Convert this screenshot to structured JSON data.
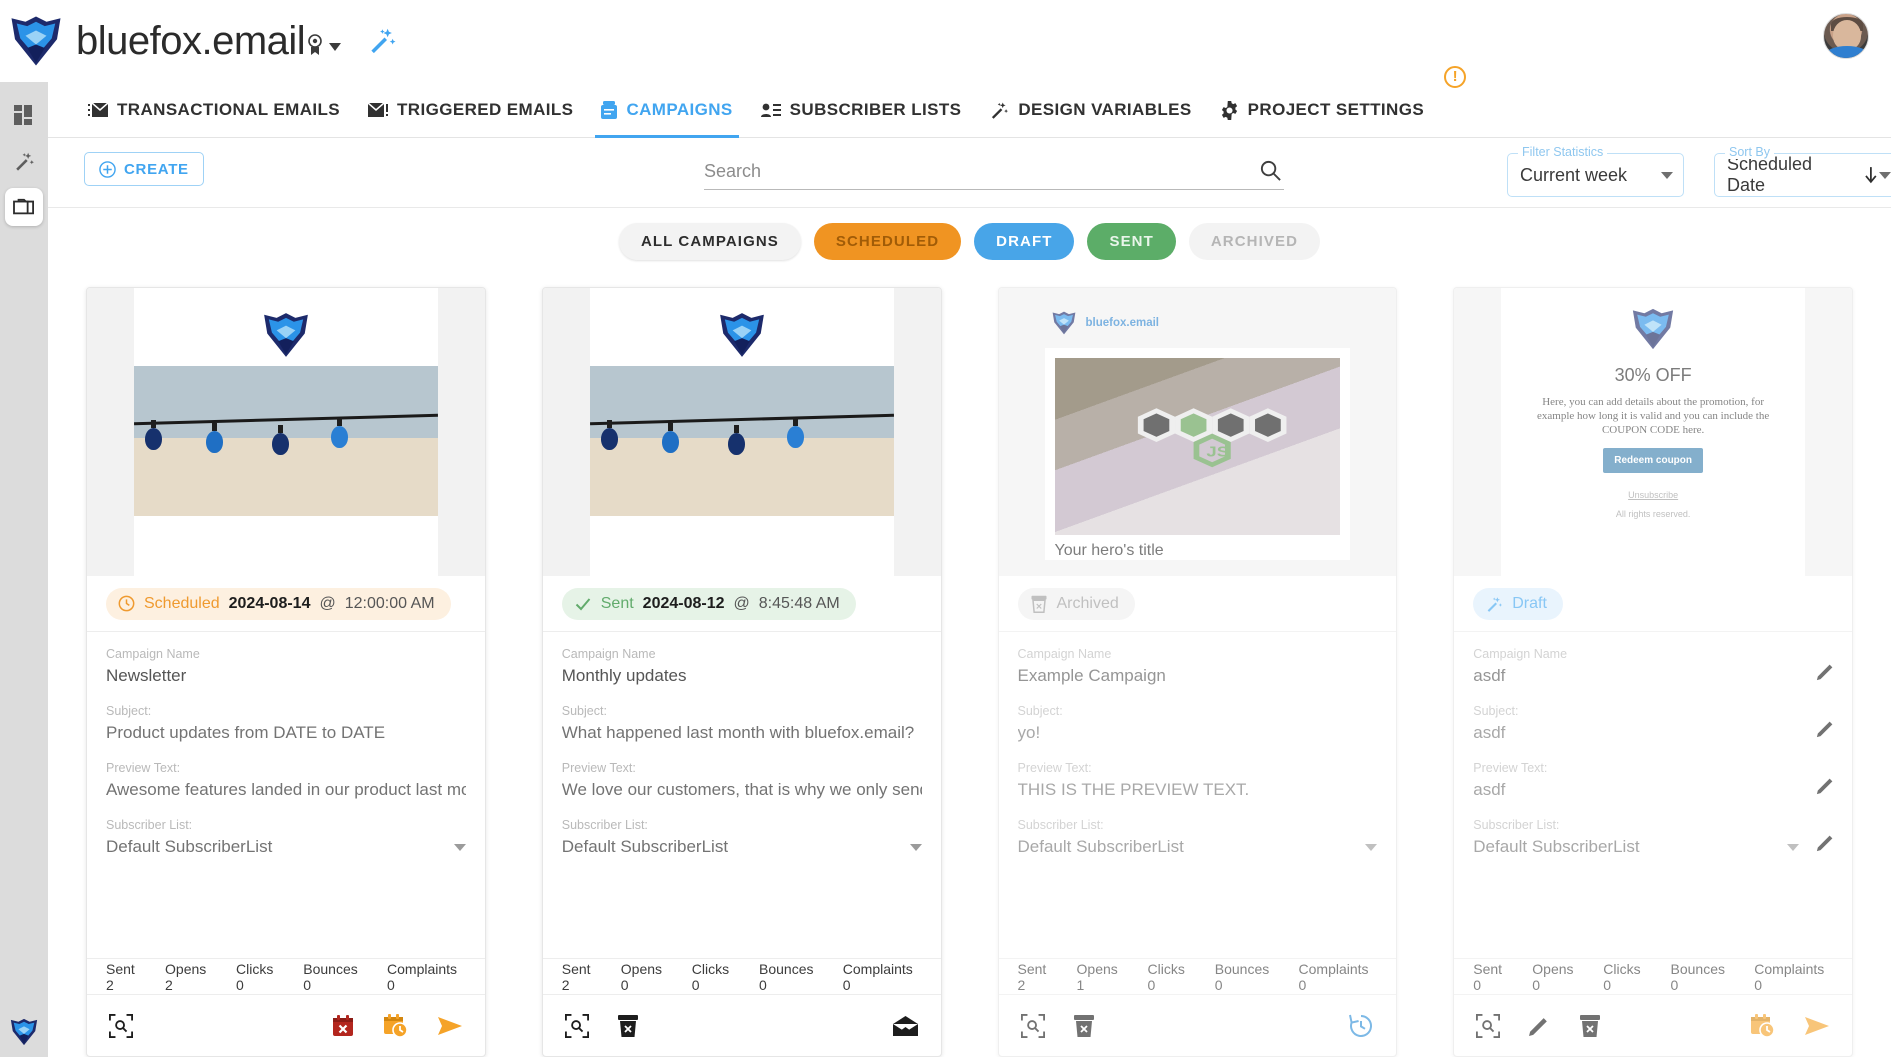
{
  "app": {
    "brand": "bluefox.email",
    "logo_icon": "bluefox-logo-icon",
    "verified_icon": "verified-badge-icon",
    "caret_icon": "chevron-down-icon",
    "wand_icon": "magic-wand-icon",
    "avatar_icon": "user-avatar",
    "accent": "#41a5f0"
  },
  "rail": {
    "items": [
      {
        "icon": "dashboard-grid-icon",
        "active": false
      },
      {
        "icon": "magic-wand-icon",
        "active": false
      },
      {
        "icon": "projects-folder-icon",
        "active": true
      }
    ],
    "footer_icon": "bluefox-logo-icon"
  },
  "nav": {
    "tabs": [
      {
        "label": "TRANSACTIONAL EMAILS",
        "icon": "transactional-email-icon",
        "active": false
      },
      {
        "label": "TRIGGERED EMAILS",
        "icon": "triggered-email-icon",
        "active": false
      },
      {
        "label": "CAMPAIGNS",
        "icon": "campaign-icon",
        "active": true
      },
      {
        "label": "SUBSCRIBER LISTS",
        "icon": "subscriber-list-icon",
        "active": false
      },
      {
        "label": "DESIGN VARIABLES",
        "icon": "magic-wand-icon",
        "active": false
      },
      {
        "label": "PROJECT SETTINGS",
        "icon": "gear-icon",
        "active": false
      }
    ],
    "warning_badge": "!"
  },
  "toolbar": {
    "create_label": "CREATE",
    "create_icon": "plus-circle-icon",
    "search_placeholder": "Search",
    "search_value": "",
    "search_icon": "search-icon",
    "filter_statistics": {
      "label": "Filter Statistics",
      "value": "Current week"
    },
    "sort_by": {
      "label": "Sort By",
      "value": "Scheduled Date",
      "direction_icon": "arrow-down-icon"
    }
  },
  "chips": [
    {
      "label": "ALL CAMPAIGNS",
      "style": "chip-all"
    },
    {
      "label": "SCHEDULED",
      "style": "chip-scheduled"
    },
    {
      "label": "DRAFT",
      "style": "chip-draft"
    },
    {
      "label": "SENT",
      "style": "chip-sent"
    },
    {
      "label": "ARCHIVED",
      "style": "chip-archived"
    }
  ],
  "labels": {
    "campaign_name": "Campaign Name",
    "subject": "Subject:",
    "preview_text": "Preview Text:",
    "subscriber_list": "Subscriber List:"
  },
  "cards": [
    {
      "status": {
        "text": "Scheduled",
        "date": "2024-08-14",
        "at": "@",
        "time": "12:00:00 AM",
        "icon": "clock-icon",
        "style": "pill-scheduled"
      },
      "campaign_name": "Newsletter",
      "subject": "Product updates from DATE to DATE",
      "preview": "Awesome features landed in our product last month",
      "subscriber_list": "Default SubscriberList",
      "stats": [
        "Sent 2",
        "Opens 2",
        "Clicks 0",
        "Bounces 0",
        "Complaints 0"
      ],
      "actions": [
        "preview-search-icon",
        "cancel-schedule-icon",
        "reschedule-icon",
        "send-icon"
      ]
    },
    {
      "status": {
        "text": "Sent",
        "date": "2024-08-12",
        "at": "@",
        "time": "8:45:48 AM",
        "icon": "check-icon",
        "style": "pill-sent"
      },
      "campaign_name": "Monthly updates",
      "subject": "What happened last month with bluefox.email?",
      "preview": "We love our customers, that is why we only send you",
      "subscriber_list": "Default SubscriberList",
      "stats": [
        "Sent 2",
        "Opens 0",
        "Clicks 0",
        "Bounces 0",
        "Complaints 0"
      ],
      "actions": [
        "preview-search-icon",
        "archive-icon",
        "open-mail-icon"
      ]
    },
    {
      "status": {
        "text": "Archived",
        "date": "",
        "at": "",
        "time": "",
        "icon": "archive-icon",
        "style": "pill-archived"
      },
      "campaign_name": "Example Campaign",
      "subject": "yo!",
      "preview": "THIS IS THE PREVIEW TEXT.",
      "subscriber_list": "Default SubscriberList",
      "stats": [
        "Sent 2",
        "Opens 1",
        "Clicks 0",
        "Bounces 0",
        "Complaints 0"
      ],
      "actions": [
        "preview-search-icon",
        "archive-icon",
        "restore-history-icon"
      ],
      "hero": {
        "brand": "bluefox.email",
        "title": "Your hero's title"
      }
    },
    {
      "status": {
        "text": "Draft",
        "date": "",
        "at": "",
        "time": "",
        "icon": "magic-wand-icon",
        "style": "pill-draft"
      },
      "campaign_name": "asdf",
      "subject": "asdf",
      "preview": "asdf",
      "subscriber_list": "Default SubscriberList",
      "stats": [
        "Sent 0",
        "Opens 0",
        "Clicks 0",
        "Bounces 0",
        "Complaints 0"
      ],
      "actions": [
        "preview-search-icon",
        "edit-pencil-icon",
        "archive-icon",
        "schedule-icon",
        "send-icon"
      ],
      "promo": {
        "title": "30% OFF",
        "body": "Here, you can add details about the promotion, for example how long it is valid and you can include the COUPON CODE here.",
        "button": "Redeem coupon",
        "unsubscribe": "Unsubscribe",
        "rights": "All rights reserved."
      }
    }
  ]
}
